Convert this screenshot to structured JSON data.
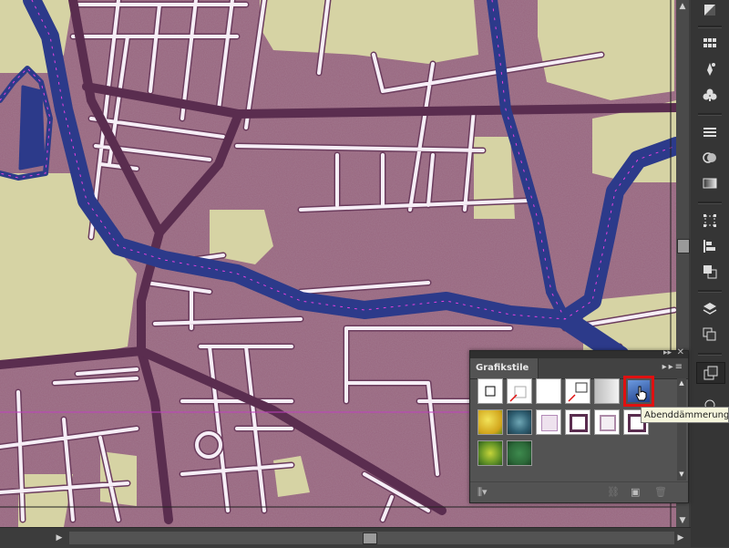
{
  "panel": {
    "title": "Grafikstile",
    "collapse_glyph": "▸▸",
    "close_glyph": "✕",
    "menu_glyph": "≡",
    "swatches": [
      {
        "row": 0,
        "col": 0,
        "name": "default-style",
        "fill": "#ffffff",
        "stroke": "#000000"
      },
      {
        "row": 0,
        "col": 1,
        "name": "white-no-stroke",
        "fill": "#ffffff",
        "stroke": "none"
      },
      {
        "row": 0,
        "col": 2,
        "name": "white-plain",
        "fill": "#ffffff",
        "stroke": "none"
      },
      {
        "row": 0,
        "col": 3,
        "name": "white-double",
        "fill": "#ffffff",
        "stroke": "#000000"
      },
      {
        "row": 0,
        "col": 4,
        "name": "gradient-grey",
        "fill": "#d5d5d5",
        "stroke": "none"
      },
      {
        "row": 0,
        "col": 5,
        "name": "abenddaemmerung",
        "fill": "#2e64b8",
        "stroke": "none",
        "selected": true
      },
      {
        "row": 1,
        "col": 0,
        "name": "yellow-texture",
        "fill": "#e2c72a",
        "stroke": "none"
      },
      {
        "row": 1,
        "col": 1,
        "name": "blue-texture",
        "fill": "#2f5f72",
        "stroke": "none"
      },
      {
        "row": 1,
        "col": 2,
        "name": "lilac-frame",
        "fill": "#eee2ee",
        "stroke": "#b38ab8"
      },
      {
        "row": 1,
        "col": 3,
        "name": "dark-purple-frame",
        "fill": "#ffffff",
        "stroke": "#5a2d4f"
      },
      {
        "row": 1,
        "col": 4,
        "name": "light-purple-frame",
        "fill": "#f3eef3",
        "stroke": "#ad8aa8"
      },
      {
        "row": 1,
        "col": 5,
        "name": "purple-frame-2",
        "fill": "#ffffff",
        "stroke": "#5a2d4f"
      },
      {
        "row": 2,
        "col": 0,
        "name": "green-yellow-texture",
        "fill": "#6c9a28",
        "stroke": "none"
      },
      {
        "row": 2,
        "col": 1,
        "name": "dark-green-texture",
        "fill": "#2d6b3a",
        "stroke": "none"
      }
    ]
  },
  "tooltip": {
    "text": "Abenddämmerung"
  },
  "colors": {
    "map_bg": "#98667f",
    "park": "#d6d3a4",
    "water": "#2c3a8a",
    "road_outline": "#5a2d4f",
    "road_fill": "#f6eef6",
    "anchor": "#e840e0",
    "selection_red": "#e01010"
  },
  "icons": {
    "tools": [
      "gradient-panel-icon",
      "swatch-grid-icon",
      "brushes-icon",
      "symbols-icon",
      "stroke-icon",
      "transparency-icon",
      "gradient-icon",
      "transform-icon",
      "align-icon",
      "pathfinder-icon",
      "layers-icon",
      "artboards-icon",
      "graphic-styles-icon",
      "appearance-icon"
    ]
  }
}
